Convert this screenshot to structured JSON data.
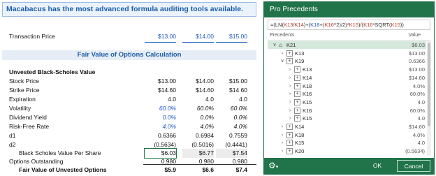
{
  "sheet": {
    "banner": "Macabacus has the most advanced formula auditing tools available.",
    "transaction": {
      "label": "Transaction Price",
      "values": [
        "$13.00",
        "$14.00",
        "$15.00"
      ]
    },
    "section_title": "Fair Value of Options Calculation",
    "unvested_title": "Unvested Black-Scholes Value",
    "rows": [
      {
        "label": "Stock Price",
        "values": [
          "$13.00",
          "$14.00",
          "$15.00"
        ]
      },
      {
        "label": "Strike Price",
        "values": [
          "$14.60",
          "$14.60",
          "$14.60"
        ]
      },
      {
        "label": "Expiration",
        "values": [
          "4.0",
          "4.0",
          "4.0"
        ]
      },
      {
        "label": "Volatility",
        "values": [
          "60.0%",
          "60.0%",
          "60.0%"
        ]
      },
      {
        "label": "Dividend Yield",
        "values": [
          "0.0%",
          "0.0%",
          "0.0%"
        ]
      },
      {
        "label": "Risk-Free Rate",
        "values": [
          "4.0%",
          "4.0%",
          "4.0%"
        ]
      },
      {
        "label": "d1",
        "values": [
          "0.6366",
          "0.6984",
          "0.7559"
        ]
      },
      {
        "label": "d2",
        "values": [
          "(0.5634)",
          "(0.5016)",
          "(0.4441)"
        ]
      },
      {
        "label": "Black Scholes Value Per Share",
        "values": [
          "$6.03",
          "$6.77",
          "$7.54"
        ]
      },
      {
        "label": "Options Outstanding",
        "values": [
          "0.980",
          "0.980",
          "0.980"
        ]
      },
      {
        "label": "Fair Value of Unvested Options",
        "values": [
          "$5.9",
          "$6.6",
          "$7.4"
        ]
      }
    ]
  },
  "window": {
    "title": "Pro Precedents",
    "formula": {
      "p1": "=(LN(",
      "p2": "K13",
      "p3": "/",
      "p4": "K14",
      "p5": ")+(",
      "p6": "K18",
      "p7": "+(",
      "p8": "K16",
      "p9": "^2)/2)*",
      "p10": "K15",
      "p11": ")/(",
      "p12": "K16",
      "p13": "*SQRT(",
      "p14": "K15",
      "p15": "))"
    },
    "col_precedents": "Precedents",
    "col_value": "Value",
    "tree": [
      {
        "name": "K21",
        "value": "$6.03",
        "level": 0,
        "expanded": true,
        "home": true,
        "selected": true
      },
      {
        "name": "K13",
        "value": "$13.00",
        "level": 1,
        "expanded": false
      },
      {
        "name": "K19",
        "value": "0.6366",
        "level": 1,
        "expanded": true
      },
      {
        "name": "K13",
        "value": "$13.00",
        "level": 2,
        "expanded": false
      },
      {
        "name": "K14",
        "value": "$14.60",
        "level": 2,
        "expanded": false
      },
      {
        "name": "K18",
        "value": "4.0%",
        "level": 2,
        "expanded": false
      },
      {
        "name": "K16",
        "value": "60.0%",
        "level": 2,
        "expanded": false
      },
      {
        "name": "K15",
        "value": "4.0",
        "level": 2,
        "expanded": false
      },
      {
        "name": "K16",
        "value": "60.0%",
        "level": 2,
        "expanded": false
      },
      {
        "name": "K15",
        "value": "4.0",
        "level": 2,
        "expanded": false
      },
      {
        "name": "K14",
        "value": "$14.60",
        "level": 1,
        "expanded": false
      },
      {
        "name": "K18",
        "value": "4.0%",
        "level": 1,
        "expanded": false
      },
      {
        "name": "K15",
        "value": "4.0",
        "level": 1,
        "expanded": false
      },
      {
        "name": "K20",
        "value": "(0.5634)",
        "level": 1,
        "expanded": false
      }
    ],
    "ok_label": "OK",
    "cancel_label": "Cancel",
    "gear_icon": "gear-icon",
    "accent": "#21734a"
  }
}
